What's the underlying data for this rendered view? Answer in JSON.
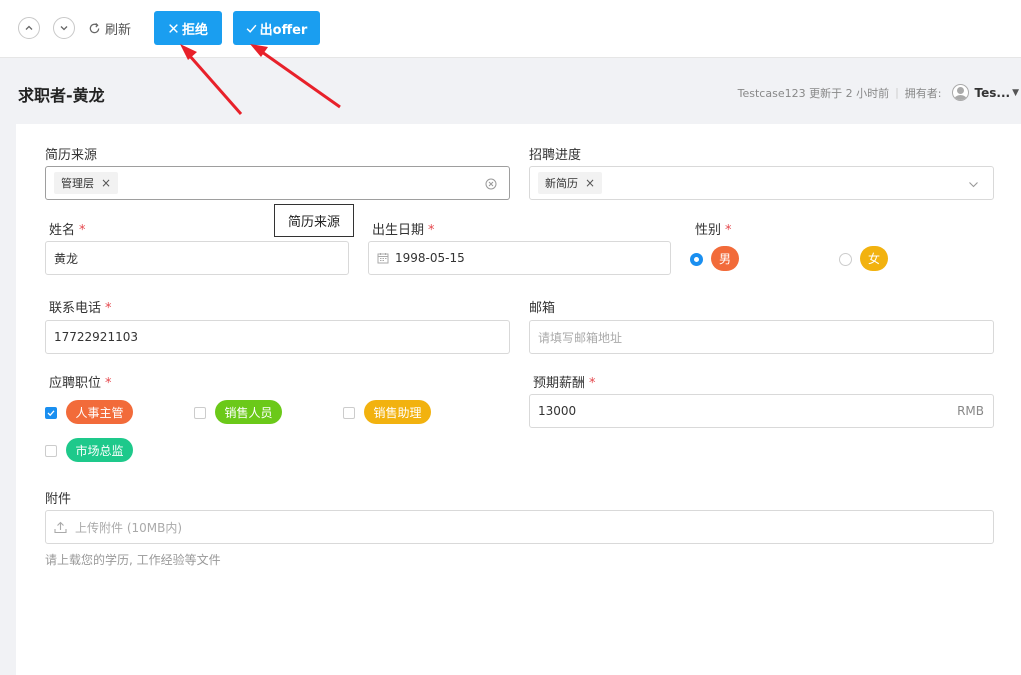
{
  "toolbar": {
    "refresh_label": "刷新",
    "reject_label": "拒绝",
    "offer_label": "出offer"
  },
  "header": {
    "title": "求职者-黄龙",
    "updated_text": "Testcase123 更新于 2 小时前",
    "owner_label": "拥有者:",
    "owner_name": "Tes..."
  },
  "form": {
    "resume_source": {
      "label": "简历来源",
      "tag": "管理层"
    },
    "tooltip_text": "简历来源",
    "recruit_progress": {
      "label": "招聘进度",
      "tag": "新简历"
    },
    "name": {
      "label": "姓名",
      "required_mark": "*",
      "value": "黄龙"
    },
    "birthdate": {
      "label": "出生日期",
      "required_mark": "*",
      "value": "1998-05-15"
    },
    "gender": {
      "label": "性别",
      "required_mark": "*",
      "options": [
        "男",
        "女"
      ],
      "selected": "男"
    },
    "phone": {
      "label": "联系电话",
      "required_mark": "*",
      "value": "17722921103"
    },
    "email": {
      "label": "邮箱",
      "placeholder": "请填写邮箱地址"
    },
    "position": {
      "label": "应聘职位",
      "required_mark": "*",
      "options": [
        "人事主管",
        "销售人员",
        "销售助理",
        "市场总监"
      ],
      "checked": [
        "人事主管"
      ]
    },
    "salary": {
      "label": "预期薪酬",
      "required_mark": "*",
      "value": "13000",
      "unit": "RMB"
    },
    "attachment": {
      "label": "附件",
      "upload_text": "上传附件 (10MB内)",
      "hint": "请上载您的学历, 工作经验等文件"
    }
  },
  "colors": {
    "primary": "#1a9ef0",
    "orange": "#f26b3a",
    "green": "#6bc919",
    "yellow": "#f2b20f",
    "teal": "#1ec98b",
    "arrow": "#e8212a"
  }
}
